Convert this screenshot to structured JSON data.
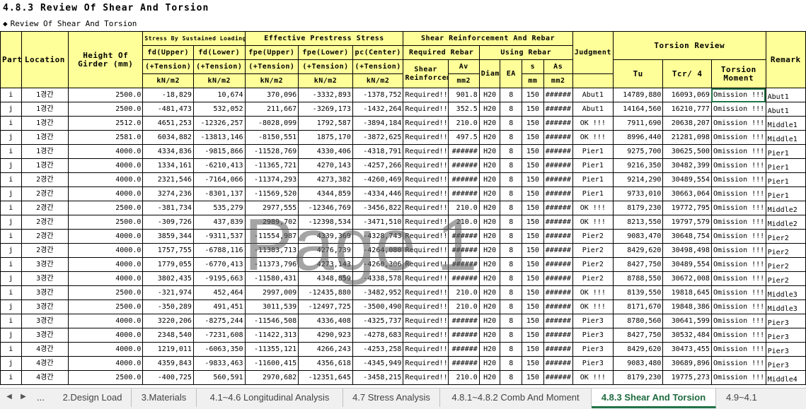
{
  "sheet": {
    "title": "4.8.3 Review Of Shear And Torsion",
    "subtitle_bullet": "◆",
    "subtitle": "Review Of Shear And Torsion",
    "watermark": "Page 1"
  },
  "headers": {
    "part": "Part",
    "location": "Location",
    "height": "Height Of Girder (mm)",
    "stress_group": "Stress By Sustained Loading",
    "fd_upper": "fd(Upper)",
    "fd_lower": "fd(Lower)",
    "prestress_group": "Effective Prestress Stress",
    "fpe_upper": "fpe(Upper)",
    "fpe_lower": "fpe(Lower)",
    "pc_center": "pc(Center)",
    "tension": "(+Tension)",
    "unit_knm2": "kN/m2",
    "shear_group": "Shear Reinforcement And Rebar",
    "required_group": "Required Rebar",
    "using_group": "Using Rebar",
    "shear_reinforcement": "Shear Reinforcement",
    "av": "Av",
    "unit_mm2": "mm2",
    "diameter": "Diameter",
    "ea": "EA",
    "s": "s",
    "unit_mm": "mm",
    "as": "As",
    "judgment": "Judgment",
    "torsion_group": "Torsion Review",
    "tu": "Tu",
    "tcr": "Tcr/ 4",
    "torsion_moment": "Torsion Moment",
    "remark": "Remark"
  },
  "rows": [
    [
      "i",
      "1경간",
      "2500.0",
      "-18,829",
      "10,674",
      "370,096",
      "-3332,893",
      "-1378,752",
      "Required!!!",
      "901.8",
      "H20",
      "8",
      "150",
      "######",
      "Abut1",
      "14789,880",
      "16093,069",
      "Omission !!!",
      "Abut1"
    ],
    [
      "j",
      "1경간",
      "2500.0",
      "-481,473",
      "532,052",
      "211,667",
      "-3269,173",
      "-1432,264",
      "Required!!!",
      "352.5",
      "H20",
      "8",
      "150",
      "######",
      "Abut1",
      "14164,560",
      "16210,777",
      "Omission !!!",
      "Abut1"
    ],
    [
      "i",
      "1경간",
      "2512.0",
      "4651,253",
      "-12326,257",
      "-8028,099",
      "1792,587",
      "-3894,184",
      "Required!!!",
      "210.0",
      "H20",
      "8",
      "150",
      "######",
      "OK !!!",
      "7911,690",
      "20638,207",
      "Omission !!!",
      "Middle1"
    ],
    [
      "j",
      "1경간",
      "2581.0",
      "6034,882",
      "-13813,146",
      "-8150,551",
      "1875,170",
      "-3872,625",
      "Required!!!",
      "497.5",
      "H20",
      "8",
      "150",
      "######",
      "OK !!!",
      "8996,440",
      "21281,098",
      "Omission !!!",
      "Middle1"
    ],
    [
      "i",
      "1경간",
      "4000.0",
      "4334,836",
      "-9815,866",
      "-11528,769",
      "4330,406",
      "-4318,791",
      "Required!!!",
      "######",
      "H20",
      "8",
      "150",
      "######",
      "Pier1",
      "9275,700",
      "30625,500",
      "Omission !!!",
      "Pier1"
    ],
    [
      "j",
      "1경간",
      "4000.0",
      "1334,161",
      "-6210,413",
      "-11365,721",
      "4270,143",
      "-4257,266",
      "Required!!!",
      "######",
      "H20",
      "8",
      "150",
      "######",
      "Pier1",
      "9216,350",
      "30482,399",
      "Omission !!!",
      "Pier1"
    ],
    [
      "i",
      "2경간",
      "4000.0",
      "2321,546",
      "-7164,066",
      "-11374,293",
      "4273,382",
      "-4260,469",
      "Required!!!",
      "######",
      "H20",
      "8",
      "150",
      "######",
      "Pier1",
      "9214,290",
      "30489,554",
      "Omission !!!",
      "Pier1"
    ],
    [
      "j",
      "2경간",
      "4000.0",
      "3274,236",
      "-8301,137",
      "-11569,520",
      "4344,859",
      "-4334,446",
      "Required!!!",
      "######",
      "H20",
      "8",
      "150",
      "######",
      "Pier1",
      "9733,010",
      "30663,064",
      "Omission !!!",
      "Pier1"
    ],
    [
      "i",
      "2경간",
      "2500.0",
      "-381,734",
      "535,279",
      "2977,555",
      "-12346,769",
      "-3456,822",
      "Required!!!",
      "210.0",
      "H20",
      "8",
      "150",
      "######",
      "OK !!!",
      "8179,230",
      "19772,795",
      "Omission !!!",
      "Middle2"
    ],
    [
      "j",
      "2경간",
      "2500.0",
      "-309,726",
      "437,839",
      "2989,702",
      "-12398,534",
      "-3471,510",
      "Required!!!",
      "210.0",
      "H20",
      "8",
      "150",
      "######",
      "OK !!!",
      "8213,550",
      "19797,579",
      "Omission !!!",
      "Middle2"
    ],
    [
      "i",
      "2경간",
      "4000.0",
      "3859,344",
      "-9311,537",
      "-11554,987",
      "4339,369",
      "-4328,743",
      "Required!!!",
      "######",
      "H20",
      "8",
      "150",
      "######",
      "Pier2",
      "9083,470",
      "30648,754",
      "Omission !!!",
      "Pier2"
    ],
    [
      "j",
      "2경간",
      "4000.0",
      "1757,755",
      "-6788,116",
      "-11383,713",
      "4276,739",
      "-4264,080",
      "Required!!!",
      "######",
      "H20",
      "8",
      "150",
      "######",
      "Pier2",
      "8429,620",
      "30498,498",
      "Omission !!!",
      "Pier2"
    ],
    [
      "i",
      "3경간",
      "4000.0",
      "1779,055",
      "-6770,413",
      "-11373,796",
      "4273,143",
      "-4260,306",
      "Required!!!",
      "######",
      "H20",
      "8",
      "150",
      "######",
      "Pier2",
      "8427,750",
      "30489,554",
      "Omission !!!",
      "Pier2"
    ],
    [
      "j",
      "3경간",
      "4000.0",
      "3802,435",
      "-9195,663",
      "-11580,431",
      "4348,859",
      "-4338,578",
      "Required!!!",
      "######",
      "H20",
      "8",
      "150",
      "######",
      "Pier2",
      "8788,550",
      "30672,008",
      "Omission !!!",
      "Pier2"
    ],
    [
      "i",
      "3경간",
      "2500.0",
      "-321,974",
      "452,464",
      "2997,009",
      "-12435,880",
      "-3482,952",
      "Required!!!",
      "210.0",
      "H20",
      "8",
      "150",
      "######",
      "OK !!!",
      "8139,550",
      "19818,645",
      "Omission !!!",
      "Middle3"
    ],
    [
      "j",
      "3경간",
      "2500.0",
      "-350,289",
      "491,451",
      "3011,539",
      "-12497,725",
      "-3500,490",
      "Required!!!",
      "210.0",
      "H20",
      "8",
      "150",
      "######",
      "OK !!!",
      "8171,670",
      "19848,386",
      "Omission !!!",
      "Middle3"
    ],
    [
      "i",
      "3경간",
      "4000.0",
      "3220,206",
      "-8275,244",
      "-11546,508",
      "4336,408",
      "-4325,737",
      "Required!!!",
      "######",
      "H20",
      "8",
      "150",
      "######",
      "Pier3",
      "8780,560",
      "30641,599",
      "Omission !!!",
      "Pier3"
    ],
    [
      "j",
      "3경간",
      "4000.0",
      "2348,540",
      "-7231,608",
      "-11422,313",
      "4290,923",
      "-4278,683",
      "Required!!!",
      "######",
      "H20",
      "8",
      "150",
      "######",
      "Pier3",
      "8427,750",
      "30532,484",
      "Omission !!!",
      "Pier3"
    ],
    [
      "i",
      "4경간",
      "4000.0",
      "1219,011",
      "-6063,350",
      "-11355,121",
      "4266,243",
      "-4253,258",
      "Required!!!",
      "######",
      "H20",
      "8",
      "150",
      "######",
      "Pier3",
      "8429,620",
      "30473,455",
      "Omission !!!",
      "Pier3"
    ],
    [
      "j",
      "4경간",
      "4000.0",
      "4359,843",
      "-9833,463",
      "-11600,415",
      "4356,618",
      "-4345,949",
      "Required!!!",
      "######",
      "H20",
      "8",
      "150",
      "######",
      "Pier3",
      "9083,480",
      "30689,896",
      "Omission !!!",
      "Pier3"
    ],
    [
      "i",
      "4경간",
      "2500.0",
      "-400,725",
      "560,591",
      "2970,682",
      "-12351,645",
      "-3458,215",
      "Required!!!",
      "210.0",
      "H20",
      "8",
      "150",
      "######",
      "OK !!!",
      "8179,230",
      "19775,273",
      "Omission !!!",
      "Middle4"
    ]
  ],
  "tabs": {
    "nav_prev_icon": "◀",
    "nav_next_icon": "▶",
    "ellipsis": "...",
    "items": [
      {
        "label": "2.Design Load",
        "active": false
      },
      {
        "label": "3.Materials",
        "active": false
      },
      {
        "label": "4.1~4.6 Longitudinal Analysis",
        "active": false
      },
      {
        "label": "4.7 Stress Analysis",
        "active": false
      },
      {
        "label": "4.8.1~4.8.2 Comb And Moment",
        "active": false
      },
      {
        "label": "4.8.3 Shear And Torsion",
        "active": true
      },
      {
        "label": "4.9~4.1",
        "active": false
      }
    ]
  }
}
